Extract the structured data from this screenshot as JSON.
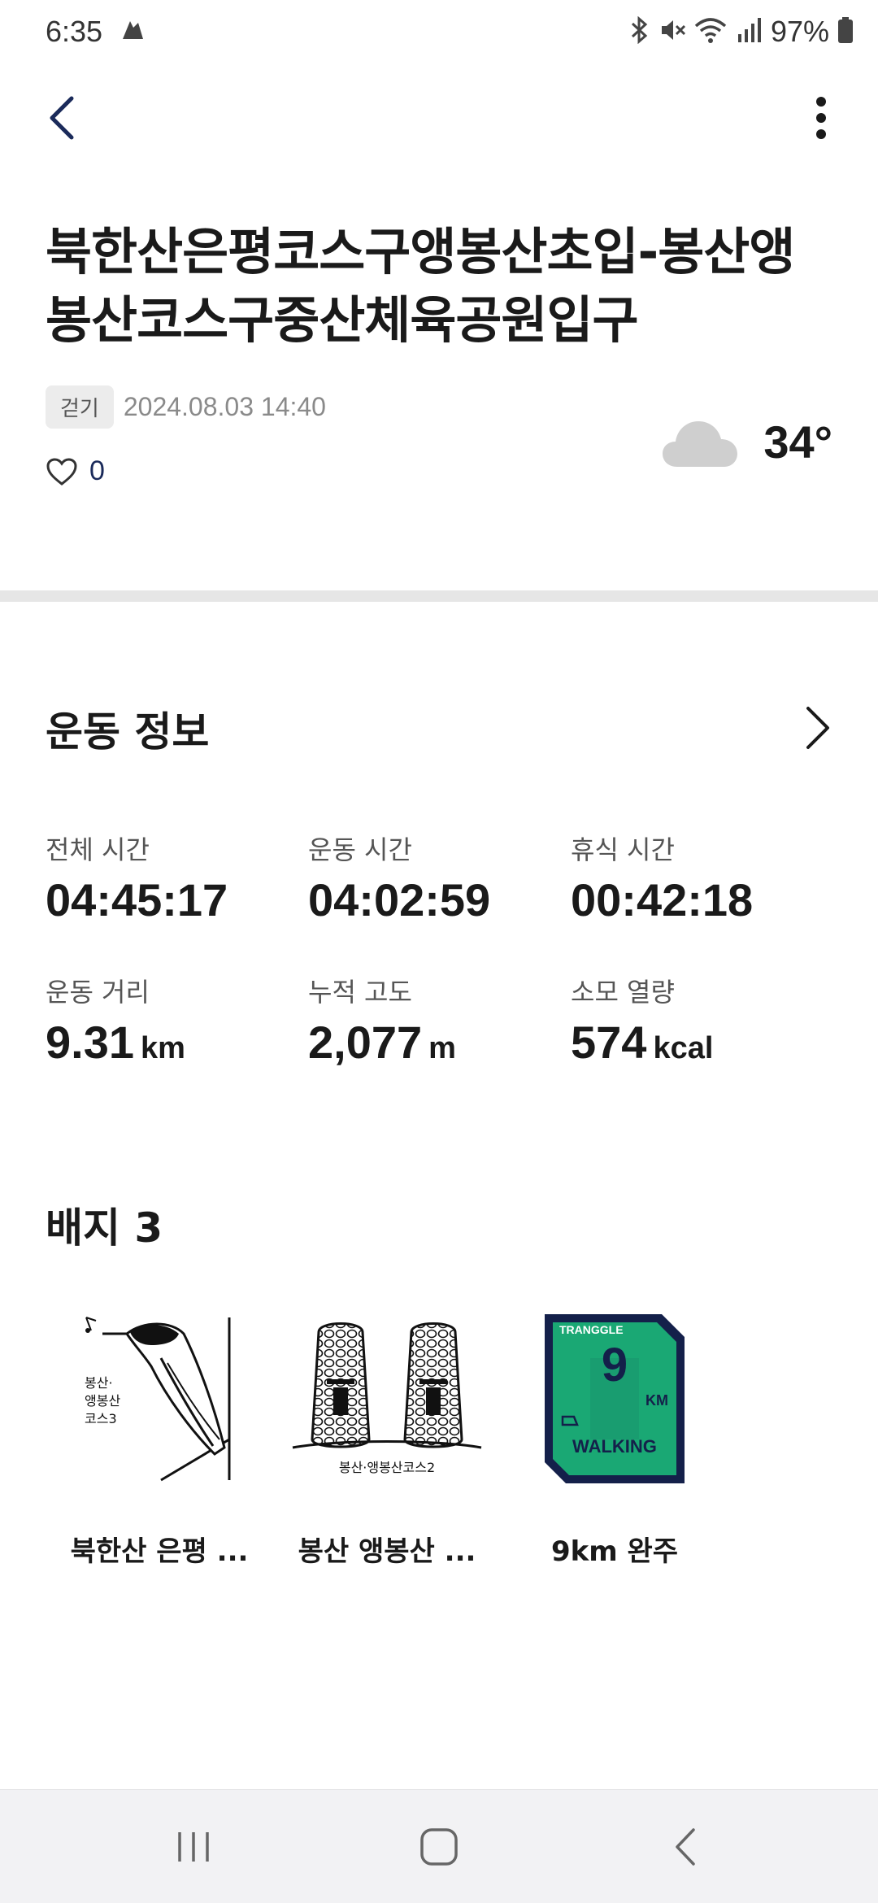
{
  "status_bar": {
    "time": "6:35",
    "battery": "97%"
  },
  "header": {
    "title": "북한산은평코스구앵봉산초입-봉산앵봉산코스구중산체육공원입구"
  },
  "meta": {
    "tag": "걷기",
    "date": "2024.08.03 14:40",
    "likes": "0"
  },
  "weather": {
    "temp": "34°",
    "icon": "cloud-icon"
  },
  "exercise": {
    "title": "운동 정보",
    "stats": [
      {
        "label": "전체 시간",
        "value": "04:45:17",
        "unit": ""
      },
      {
        "label": "운동 시간",
        "value": "04:02:59",
        "unit": ""
      },
      {
        "label": "휴식 시간",
        "value": "00:42:18",
        "unit": ""
      },
      {
        "label": "운동 거리",
        "value": "9.31",
        "unit": "km"
      },
      {
        "label": "누적 고도",
        "value": "2,077",
        "unit": "m"
      },
      {
        "label": "소모 열량",
        "value": "574",
        "unit": "kcal"
      }
    ]
  },
  "badges": {
    "title": "배지 3",
    "items": [
      {
        "name": "북한산 은평 ...",
        "caption": "봉산·앵봉산 코스3"
      },
      {
        "name": "봉산 앵봉산 ...",
        "caption": "봉산·앵봉산코스2"
      },
      {
        "name": "9km 완주",
        "brand": "TRANGGLE",
        "number": "9",
        "unit": "KM",
        "label": "WALKING"
      }
    ]
  },
  "colors": {
    "badge_navy": "#14204a",
    "badge_green": "#1aa874"
  }
}
